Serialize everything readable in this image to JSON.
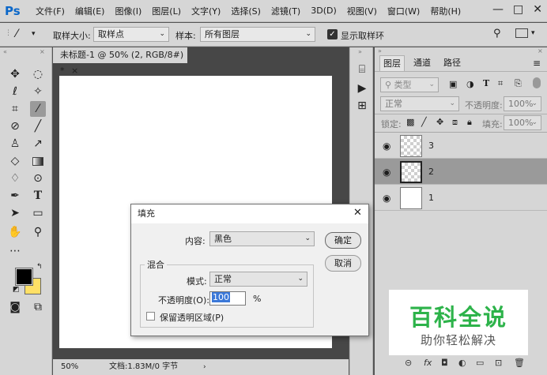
{
  "menubar": {
    "logo": "Ps",
    "items": [
      "文件(F)",
      "编辑(E)",
      "图像(I)",
      "图层(L)",
      "文字(Y)",
      "选择(S)",
      "滤镜(T)",
      "3D(D)",
      "视图(V)",
      "窗口(W)",
      "帮助(H)"
    ],
    "window_buttons": [
      "—",
      "□",
      "✕"
    ]
  },
  "options": {
    "sample_size_label": "取样大小:",
    "sample_size_value": "取样点",
    "sample_label": "样本:",
    "sample_value": "所有图层",
    "show_ring_label": "显示取样环"
  },
  "document": {
    "tab_title": "未标题-1 @ 50% (2, RGB/8#) *",
    "tab_close": "×",
    "zoom": "50%",
    "doc_info": "文档:1.83M/0 字节"
  },
  "layers_panel": {
    "tabs": [
      "图层",
      "通道",
      "路径"
    ],
    "filter_label": "类型",
    "blend_mode": "正常",
    "opacity_label": "不透明度:",
    "opacity_value": "100%",
    "lock_label": "锁定:",
    "fill_label": "填充:",
    "fill_value": "100%",
    "layers": [
      {
        "name": "3",
        "selected": false,
        "transparent": true
      },
      {
        "name": "2",
        "selected": true,
        "transparent": true
      },
      {
        "name": "1",
        "selected": false,
        "transparent": false
      }
    ]
  },
  "dialog": {
    "title": "填充",
    "content_label": "内容:",
    "content_value": "黑色",
    "ok_label": "确定",
    "cancel_label": "取消",
    "blend_group_label": "混合",
    "mode_label": "模式:",
    "mode_value": "正常",
    "opacity_label": "不透明度(O):",
    "opacity_value": "100",
    "opacity_unit": "%",
    "preserve_label": "保留透明区域(P)"
  },
  "watermark": {
    "title": "百科全说",
    "subtitle": "助你轻松解决"
  },
  "colors": {
    "foreground": "#000000",
    "background": "#ffe066",
    "ps_blue": "#0b67c9",
    "watermark_green": "#2db34a"
  }
}
